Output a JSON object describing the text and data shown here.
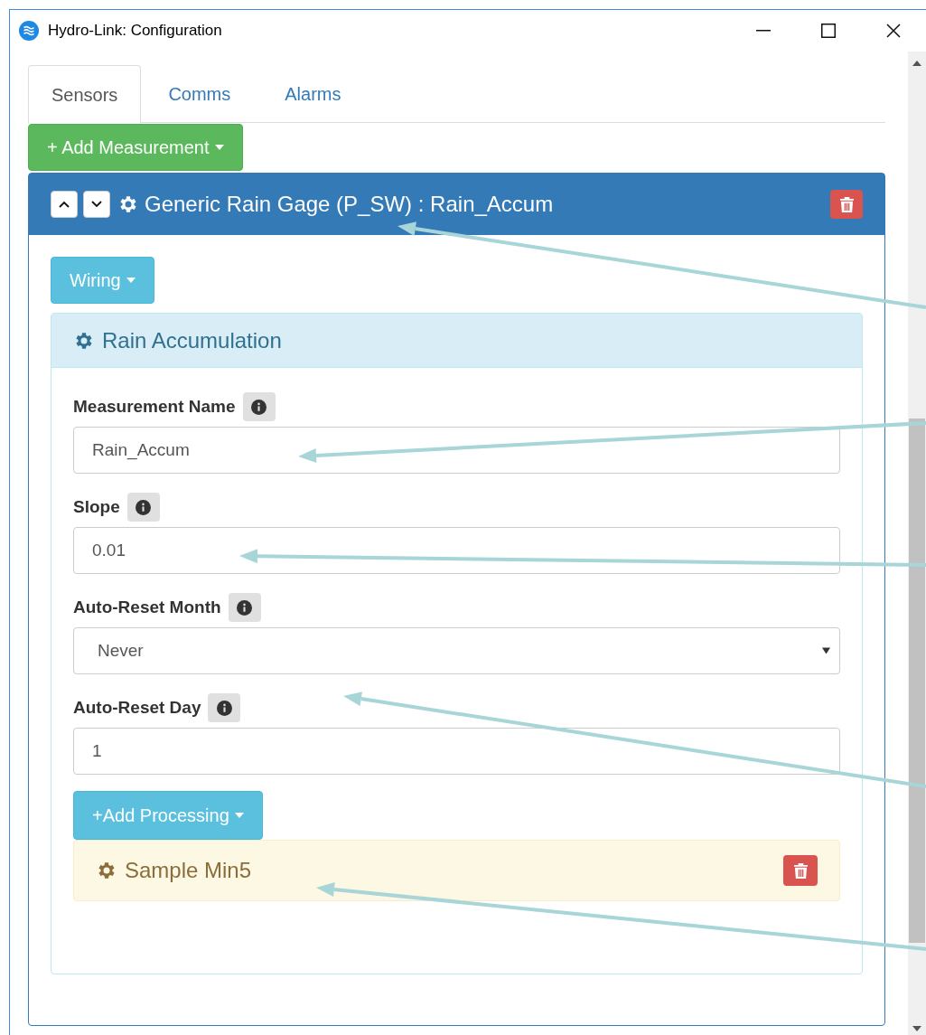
{
  "window": {
    "title": "Hydro-Link: Configuration"
  },
  "tabs": [
    {
      "label": "Sensors",
      "selected": true
    },
    {
      "label": "Comms",
      "selected": false
    },
    {
      "label": "Alarms",
      "selected": false
    }
  ],
  "add_measurement_button": "+ Add Measurement",
  "sensor": {
    "title": "Generic Rain Gage (P_SW) : Rain_Accum",
    "wiring_button": "Wiring",
    "measurement": {
      "title": "Rain Accumulation",
      "fields": [
        {
          "kind": "input",
          "label": "Measurement Name",
          "value": "Rain_Accum"
        },
        {
          "kind": "input",
          "label": "Slope",
          "value": "0.01"
        },
        {
          "kind": "select",
          "label": "Auto-Reset Month",
          "value": "Never"
        },
        {
          "kind": "input",
          "label": "Auto-Reset Day",
          "value": "1"
        }
      ],
      "add_processing_button": "+Add Processing",
      "processing": [
        {
          "title": "Sample Min5"
        }
      ]
    }
  }
}
